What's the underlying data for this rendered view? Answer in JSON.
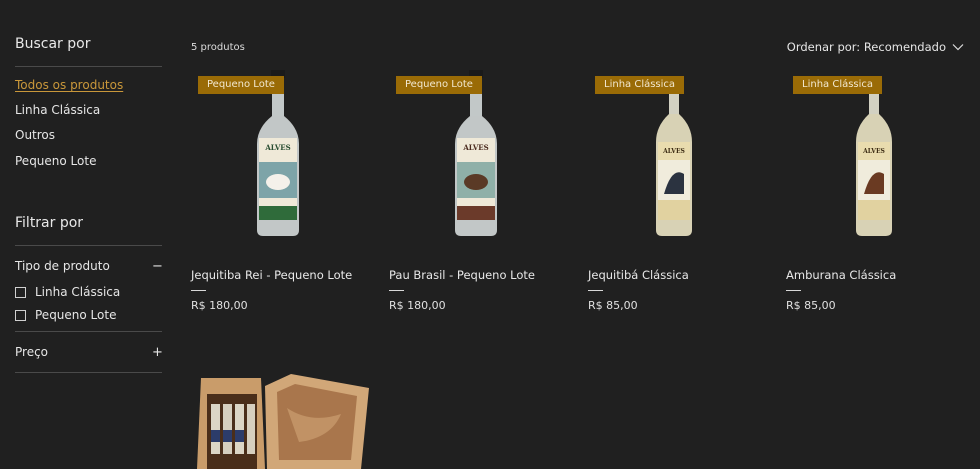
{
  "sidebar": {
    "browse_heading": "Buscar por",
    "categories": [
      {
        "label": "Todos os produtos",
        "active": true
      },
      {
        "label": "Linha Clássica",
        "active": false
      },
      {
        "label": "Outros",
        "active": false
      },
      {
        "label": "Pequeno Lote",
        "active": false
      }
    ],
    "filter_heading": "Filtrar por",
    "product_type": {
      "label": "Tipo de produto",
      "toggle": "−",
      "options": [
        "Linha Clássica",
        "Pequeno Lote"
      ]
    },
    "price": {
      "label": "Preço",
      "toggle": "+"
    }
  },
  "toolbar": {
    "count": "5 produtos",
    "sort_label": "Ordenar por: Recomendado"
  },
  "products": [
    {
      "ribbon": "Pequeno Lote",
      "name": "Jequitiba Rei - Pequeno Lote",
      "price": "R$ 180,00",
      "label_color": "#2f6b3a"
    },
    {
      "ribbon": "Pequeno Lote",
      "name": "Pau Brasil - Pequeno Lote",
      "price": "R$ 180,00",
      "label_color": "#6b3a2a"
    },
    {
      "ribbon": "Linha Clássica",
      "name": "Jequitibá Clássica",
      "price": "R$ 85,00",
      "label_color": "#d8c890"
    },
    {
      "ribbon": "Linha Clássica",
      "name": "Amburana Clássica",
      "price": "R$ 85,00",
      "label_color": "#d8c890"
    }
  ],
  "colors": {
    "background": "#202020",
    "accent": "#c9973a",
    "ribbon": "#9a6b06"
  }
}
